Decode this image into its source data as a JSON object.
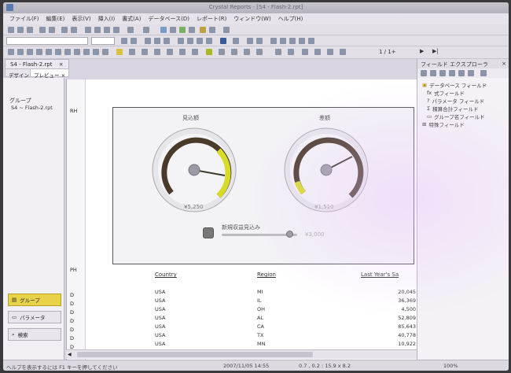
{
  "window": {
    "title": "Crystal Reports - [S4 - Flash-2.rpt]"
  },
  "menu": [
    "ファイル(F)",
    "編集(E)",
    "表示(V)",
    "挿入(I)",
    "書式(A)",
    "データベース(D)",
    "レポート(R)",
    "ウィンドウ(W)",
    "ヘルプ(H)"
  ],
  "toolbar": {
    "page_count": "1 / 1+"
  },
  "document_tab": "S4 - Flash-2.rpt",
  "view_tabs": [
    "デザイン",
    "プレビュー"
  ],
  "left_panel": {
    "group_label": "グループ",
    "group_item": "S4 ~ Flash-2.rpt",
    "buttons": [
      "グループ",
      "パラメータ",
      "検索"
    ]
  },
  "report": {
    "section_rh": "RH",
    "section_ph": "PH",
    "section_d": "D",
    "gauge1": {
      "title": "見込額",
      "value_text": "¥5,250",
      "needle_fraction": 0.72
    },
    "gauge2": {
      "title": "差額",
      "value_text": "¥1,510",
      "needle_fraction": 0.58
    },
    "slider": {
      "label": "新規収益見込み",
      "value_text": "¥3,000",
      "position_fraction": 0.9
    },
    "table": {
      "headers": [
        "Country",
        "Region",
        "Last Year's Sa"
      ],
      "rows": [
        [
          "USA",
          "MI",
          "20,045"
        ],
        [
          "USA",
          "IL",
          "36,369"
        ],
        [
          "USA",
          "OH",
          "4,500"
        ],
        [
          "USA",
          "AL",
          "52,809"
        ],
        [
          "USA",
          "CA",
          "85,643"
        ],
        [
          "USA",
          "TX",
          "40,778"
        ],
        [
          "USA",
          "MN",
          "10,922"
        ]
      ]
    }
  },
  "field_explorer": {
    "title": "フィールド エクスプローラ",
    "items": [
      "データベース フィールド",
      "式フィールド",
      "パラメータ フィールド",
      "積算合計フィールド",
      "グループ名フィールド",
      "特殊フィールド"
    ]
  },
  "status": {
    "help": "ヘルプを表示するには F1 キーを押してください",
    "date": "2007/11/05  14:55",
    "coords": "0.7 , 0.2 : 15.9 x 8.2",
    "zoom": "100%"
  },
  "colors": {
    "gauge_dark": "#4a3a2a",
    "gauge_accent": "#d8dc28",
    "highlight": "#e8d24a"
  }
}
